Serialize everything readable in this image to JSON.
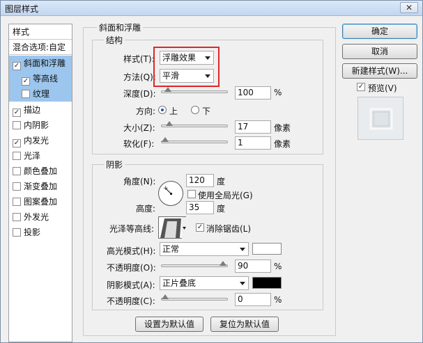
{
  "window": {
    "title": "图层样式",
    "close_glyph": "✕"
  },
  "styles_list": [
    {
      "label": "样式",
      "kind": "header"
    },
    {
      "label": "混合选项:自定",
      "kind": "header"
    },
    {
      "label": "斜面和浮雕",
      "checked": true,
      "selected": true
    },
    {
      "label": "等高线",
      "checked": true,
      "sub": true
    },
    {
      "label": "纹理",
      "checked": false,
      "sub": true
    },
    {
      "label": "描边",
      "checked": true
    },
    {
      "label": "内阴影",
      "checked": false
    },
    {
      "label": "内发光",
      "checked": true
    },
    {
      "label": "光泽",
      "checked": false
    },
    {
      "label": "颜色叠加",
      "checked": false
    },
    {
      "label": "渐变叠加",
      "checked": false
    },
    {
      "label": "图案叠加",
      "checked": false
    },
    {
      "label": "外发光",
      "checked": false
    },
    {
      "label": "投影",
      "checked": false
    }
  ],
  "bevel": {
    "group_title": "斜面和浮雕",
    "structure": {
      "title": "结构",
      "style_label": "样式(T):",
      "style_value": "浮雕效果",
      "method_label": "方法(Q):",
      "method_value": "平滑",
      "depth_label": "深度(D):",
      "depth_value": "100",
      "depth_unit": "%",
      "direction_label": "方向:",
      "dir_up": "上",
      "dir_down": "下",
      "size_label": "大小(Z):",
      "size_value": "17",
      "size_unit": "像素",
      "soften_label": "软化(F):",
      "soften_value": "1",
      "soften_unit": "像素"
    },
    "shading": {
      "title": "阴影",
      "angle_label": "角度(N):",
      "angle_value": "120",
      "angle_unit": "度",
      "global_light_label": "使用全局光(G)",
      "altitude_label": "高度:",
      "altitude_value": "35",
      "altitude_unit": "度",
      "gloss_label": "光泽等高线:",
      "antialias_label": "消除锯齿(L)",
      "highlight_label": "高光模式(H):",
      "highlight_value": "正常",
      "hl_opacity_label": "不透明度(O):",
      "hl_opacity_value": "90",
      "hl_opacity_unit": "%",
      "shadow_label": "阴影模式(A):",
      "shadow_value": "正片叠底",
      "sh_opacity_label": "不透明度(C):",
      "sh_opacity_value": "0",
      "sh_opacity_unit": "%"
    },
    "buttons": {
      "set_default": "设置为默认值",
      "reset_default": "复位为默认值"
    }
  },
  "right": {
    "ok": "确定",
    "cancel": "取消",
    "new_style": "新建样式(W)...",
    "preview_label": "预览(V)"
  },
  "colors": {
    "highlight_swatch": "#ffffff",
    "shadow_swatch": "#000000",
    "selection": "#9dc6ee",
    "red_box": "#e0262a"
  }
}
